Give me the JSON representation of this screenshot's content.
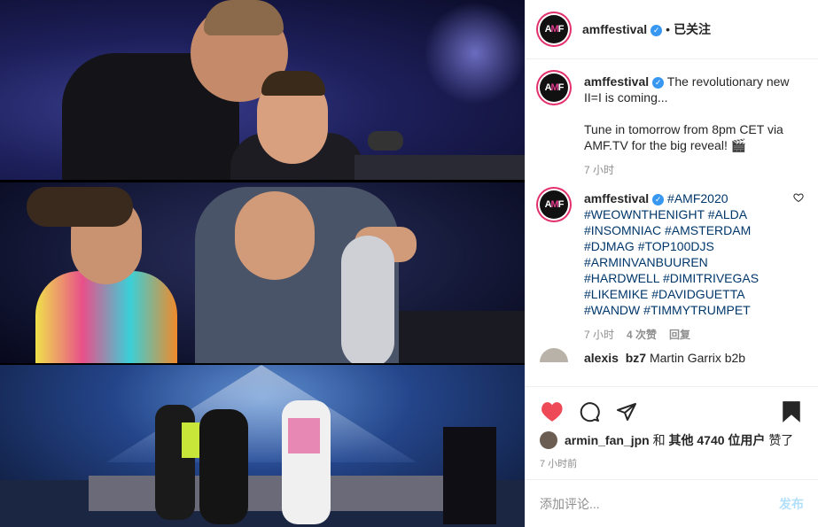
{
  "header": {
    "username": "amffestival",
    "separator": "•",
    "follow_label": "已关注"
  },
  "avatar": {
    "logo_text": "AMF"
  },
  "comments": [
    {
      "username": "amffestival",
      "lines": [
        "The revolutionary new II=I is coming...",
        "",
        "Tune in tomorrow from 8pm CET via AMF.TV for the big reveal! 🎬"
      ],
      "time": "7 小时"
    },
    {
      "username": "amffestival",
      "hashtags": [
        "#AMF2020",
        "#WEOWNTHENIGHT",
        "#ALDA",
        "#INSOMNIAC",
        "#AMSTERDAM",
        "#DJMAG",
        "#TOP100DJS",
        "#ARMINVANBUUREN",
        "#HARDWELL",
        "#DIMITRIVEGAS",
        "#LIKEMIKE",
        "#DAVIDGUETTA",
        "#WANDW",
        "#TIMMYTRUMPET"
      ],
      "time": "7 小时",
      "likes": "4 次赞",
      "reply": "回复"
    },
    {
      "username_partial": "alexis_bz7",
      "text_partial": "Martin Garrix b2b"
    }
  ],
  "likes": {
    "liker": "armin_fan_jpn",
    "middle": "和",
    "others": "其他 4740 位用户",
    "suffix": "赞了"
  },
  "timestamp": "7 小时前",
  "add_comment": {
    "placeholder": "添加评论...",
    "post_label": "发布"
  },
  "colors": {
    "heart": "#ed4956",
    "hashtag": "#00376b",
    "verified": "#3897f0",
    "post_disabled": "#b2dffc"
  },
  "icons": [
    "heart-filled-icon",
    "comment-icon",
    "share-icon",
    "bookmark-filled-icon",
    "heart-outline-icon",
    "verified-icon"
  ]
}
